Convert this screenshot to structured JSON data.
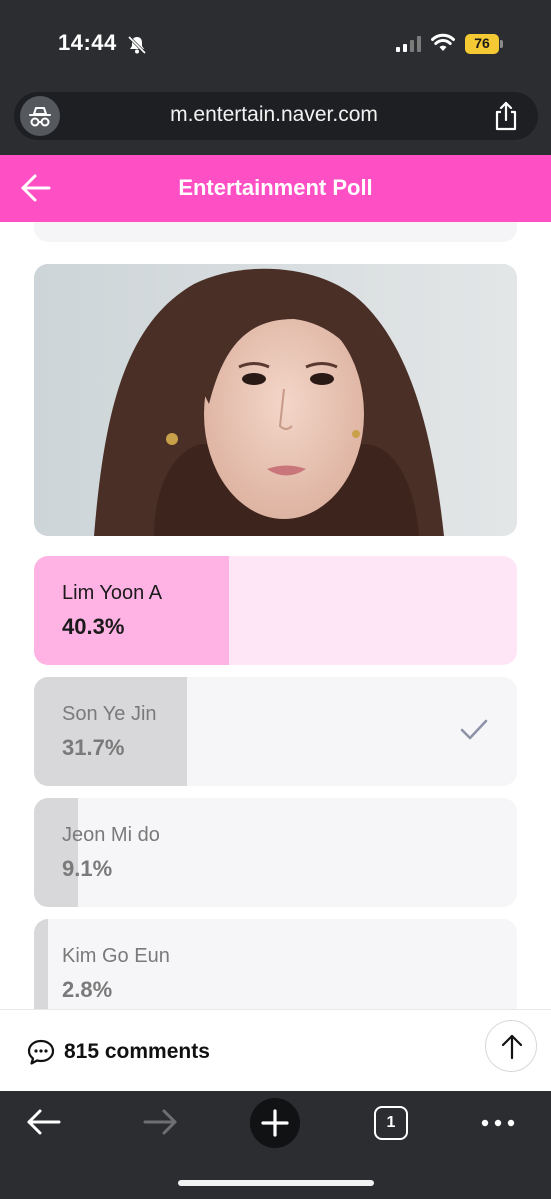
{
  "status_bar": {
    "time": "14:44",
    "battery_percent": "76",
    "icons": [
      "bell-off-icon",
      "signal-icon",
      "wifi-icon",
      "battery-icon"
    ]
  },
  "browser": {
    "url": "m.entertain.naver.com",
    "icons": [
      "site-settings-icon",
      "share-icon"
    ]
  },
  "header": {
    "title": "Entertainment Poll",
    "back_icon": "arrow-left-icon"
  },
  "poll": {
    "options": [
      {
        "name": "Lim Yoon A",
        "percent_label": "40.3%",
        "percent": 40.3,
        "leading": true,
        "selected": false
      },
      {
        "name": "Son Ye Jin",
        "percent_label": "31.7%",
        "percent": 31.7,
        "leading": false,
        "selected": true
      },
      {
        "name": "Jeon Mi do",
        "percent_label": "9.1%",
        "percent": 9.1,
        "leading": false,
        "selected": false
      },
      {
        "name": "Kim Go Eun",
        "percent_label": "2.8%",
        "percent": 2.8,
        "leading": false,
        "selected": false
      }
    ]
  },
  "comments": {
    "count_label": "815 comments",
    "icon": "speech-bubble-icon"
  },
  "toolbar": {
    "tab_count": "1",
    "icons": [
      "back-icon",
      "forward-icon",
      "plus-icon",
      "tabs-icon",
      "more-icon"
    ]
  },
  "colors": {
    "accent": "#ff4fc5",
    "leading_fill": "#ffb3e4",
    "leading_bg": "#ffe6f6",
    "option_fill": "#d8d8da",
    "option_bg": "#f6f6f8",
    "chrome": "#2b2d30"
  }
}
